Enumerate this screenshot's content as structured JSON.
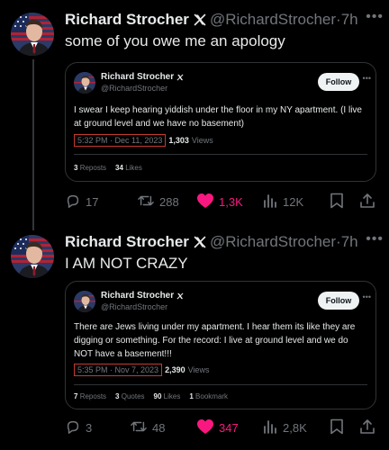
{
  "author": {
    "name": "Richard Strocher",
    "handle": "@RichardStrocher"
  },
  "colors": {
    "background": "#000000",
    "text": "#e7e9ea",
    "muted": "#71767b",
    "border": "#2f3336",
    "like": "#f91880",
    "highlight_box": "#c43a2f"
  },
  "posts": [
    {
      "time": "7h",
      "text": "some of you owe me an apology",
      "quote": {
        "name": "Richard Strocher",
        "handle": "@RichardStrocher",
        "follow_label": "Follow",
        "text": "I swear I keep hearing yiddish under the floor in my NY apartment. (I live at ground level and we have no basement)",
        "timestamp": "5:32 PM · Dec 11, 2023",
        "views": "1,303",
        "views_label": "Views",
        "stats": [
          {
            "num": "3",
            "label": "Reposts"
          },
          {
            "num": "34",
            "label": "Likes"
          }
        ]
      },
      "actions": {
        "replies": "17",
        "reposts": "288",
        "likes": "1,3K",
        "views": "12K"
      }
    },
    {
      "time": "7h",
      "text": "I AM NOT CRAZY",
      "quote": {
        "name": "Richard Strocher",
        "handle": "@RichardStrocher",
        "follow_label": "Follow",
        "text": "There are Jews living under my apartment. I hear them its like they are digging or something. For the record: I live at ground level and we do NOT have a basement!!!",
        "timestamp": "5:35 PM · Nov 7, 2023",
        "views": "2,390",
        "views_label": "Views",
        "stats": [
          {
            "num": "7",
            "label": "Reposts"
          },
          {
            "num": "3",
            "label": "Quotes"
          },
          {
            "num": "90",
            "label": "Likes"
          },
          {
            "num": "1",
            "label": "Bookmark"
          }
        ]
      },
      "actions": {
        "replies": "3",
        "reposts": "48",
        "likes": "347",
        "views": "2,8K"
      }
    }
  ]
}
